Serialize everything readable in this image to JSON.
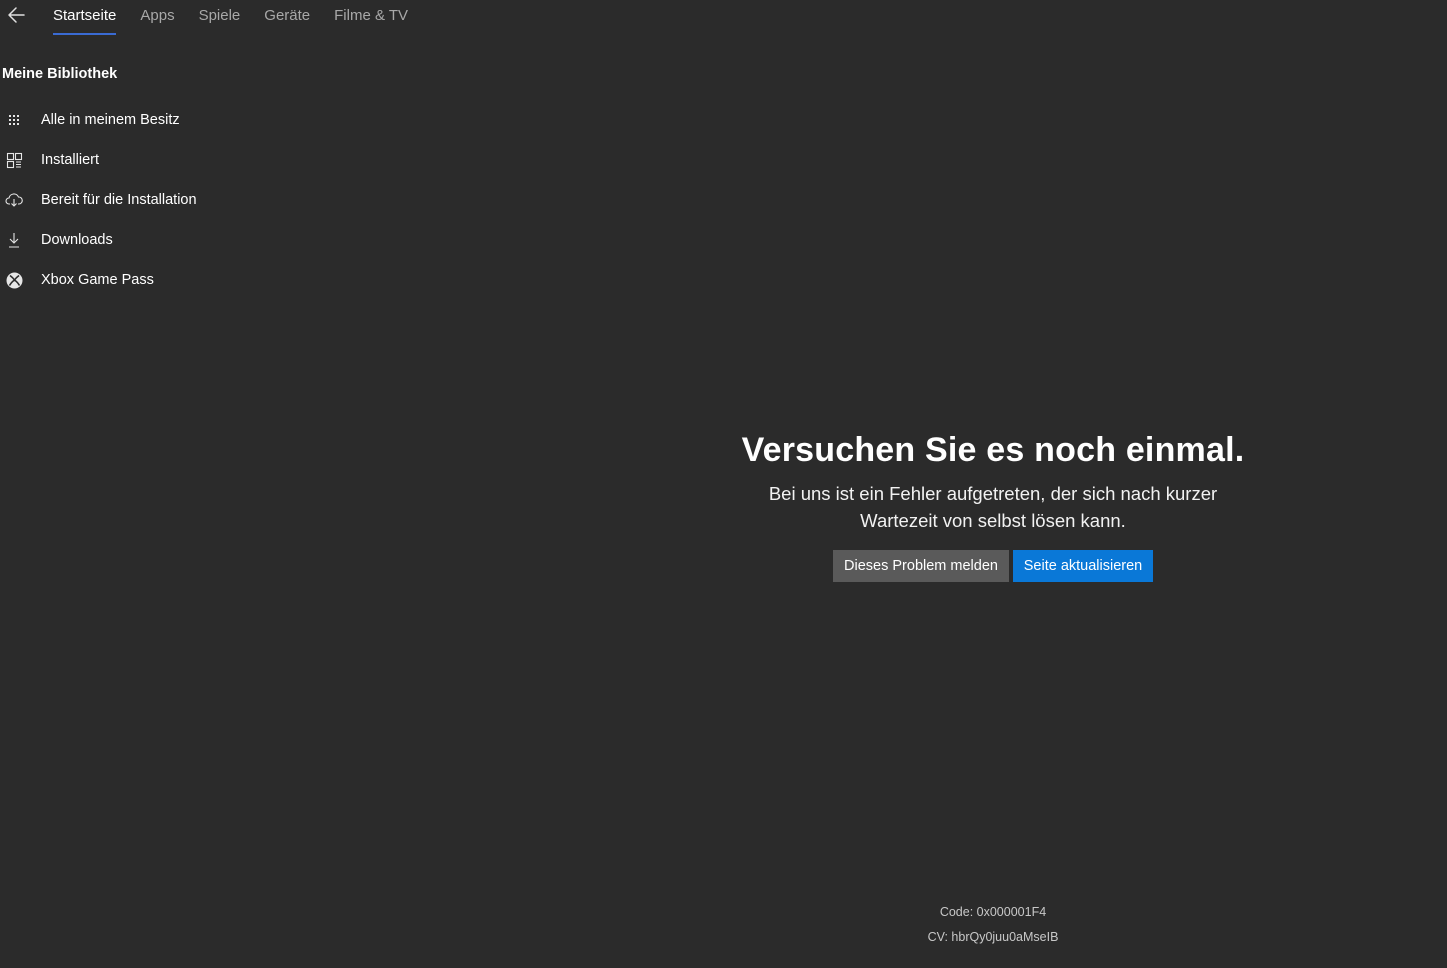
{
  "nav": {
    "back_label": "",
    "tabs": [
      {
        "label": "Startseite",
        "active": true
      },
      {
        "label": "Apps",
        "active": false
      },
      {
        "label": "Spiele",
        "active": false
      },
      {
        "label": "Geräte",
        "active": false
      },
      {
        "label": "Filme & TV",
        "active": false
      }
    ],
    "accent_color": "#3a6bd3"
  },
  "library": {
    "title": "Meine Bibliothek",
    "items": [
      {
        "label": "Alle in meinem Besitz",
        "icon": "grid-dots-icon"
      },
      {
        "label": "Installiert",
        "icon": "installed-grid-icon"
      },
      {
        "label": "Bereit für die Installation",
        "icon": "cloud-download-icon"
      },
      {
        "label": "Downloads",
        "icon": "download-arrow-icon"
      },
      {
        "label": "Xbox Game Pass",
        "icon": "xbox-logo-icon"
      }
    ]
  },
  "error": {
    "title": "Versuchen Sie es noch einmal.",
    "message_line1": "Bei uns ist ein Fehler aufgetreten, der sich nach kurzer",
    "message_line2": "Wartezeit von selbst lösen kann.",
    "report_button": "Dieses Problem melden",
    "refresh_button": "Seite aktualisieren",
    "primary_color": "#0a78d7",
    "secondary_color": "#5a5a5a"
  },
  "codes": {
    "code": "Code: 0x000001F4",
    "cv": "CV: hbrQy0juu0aMseIB"
  }
}
